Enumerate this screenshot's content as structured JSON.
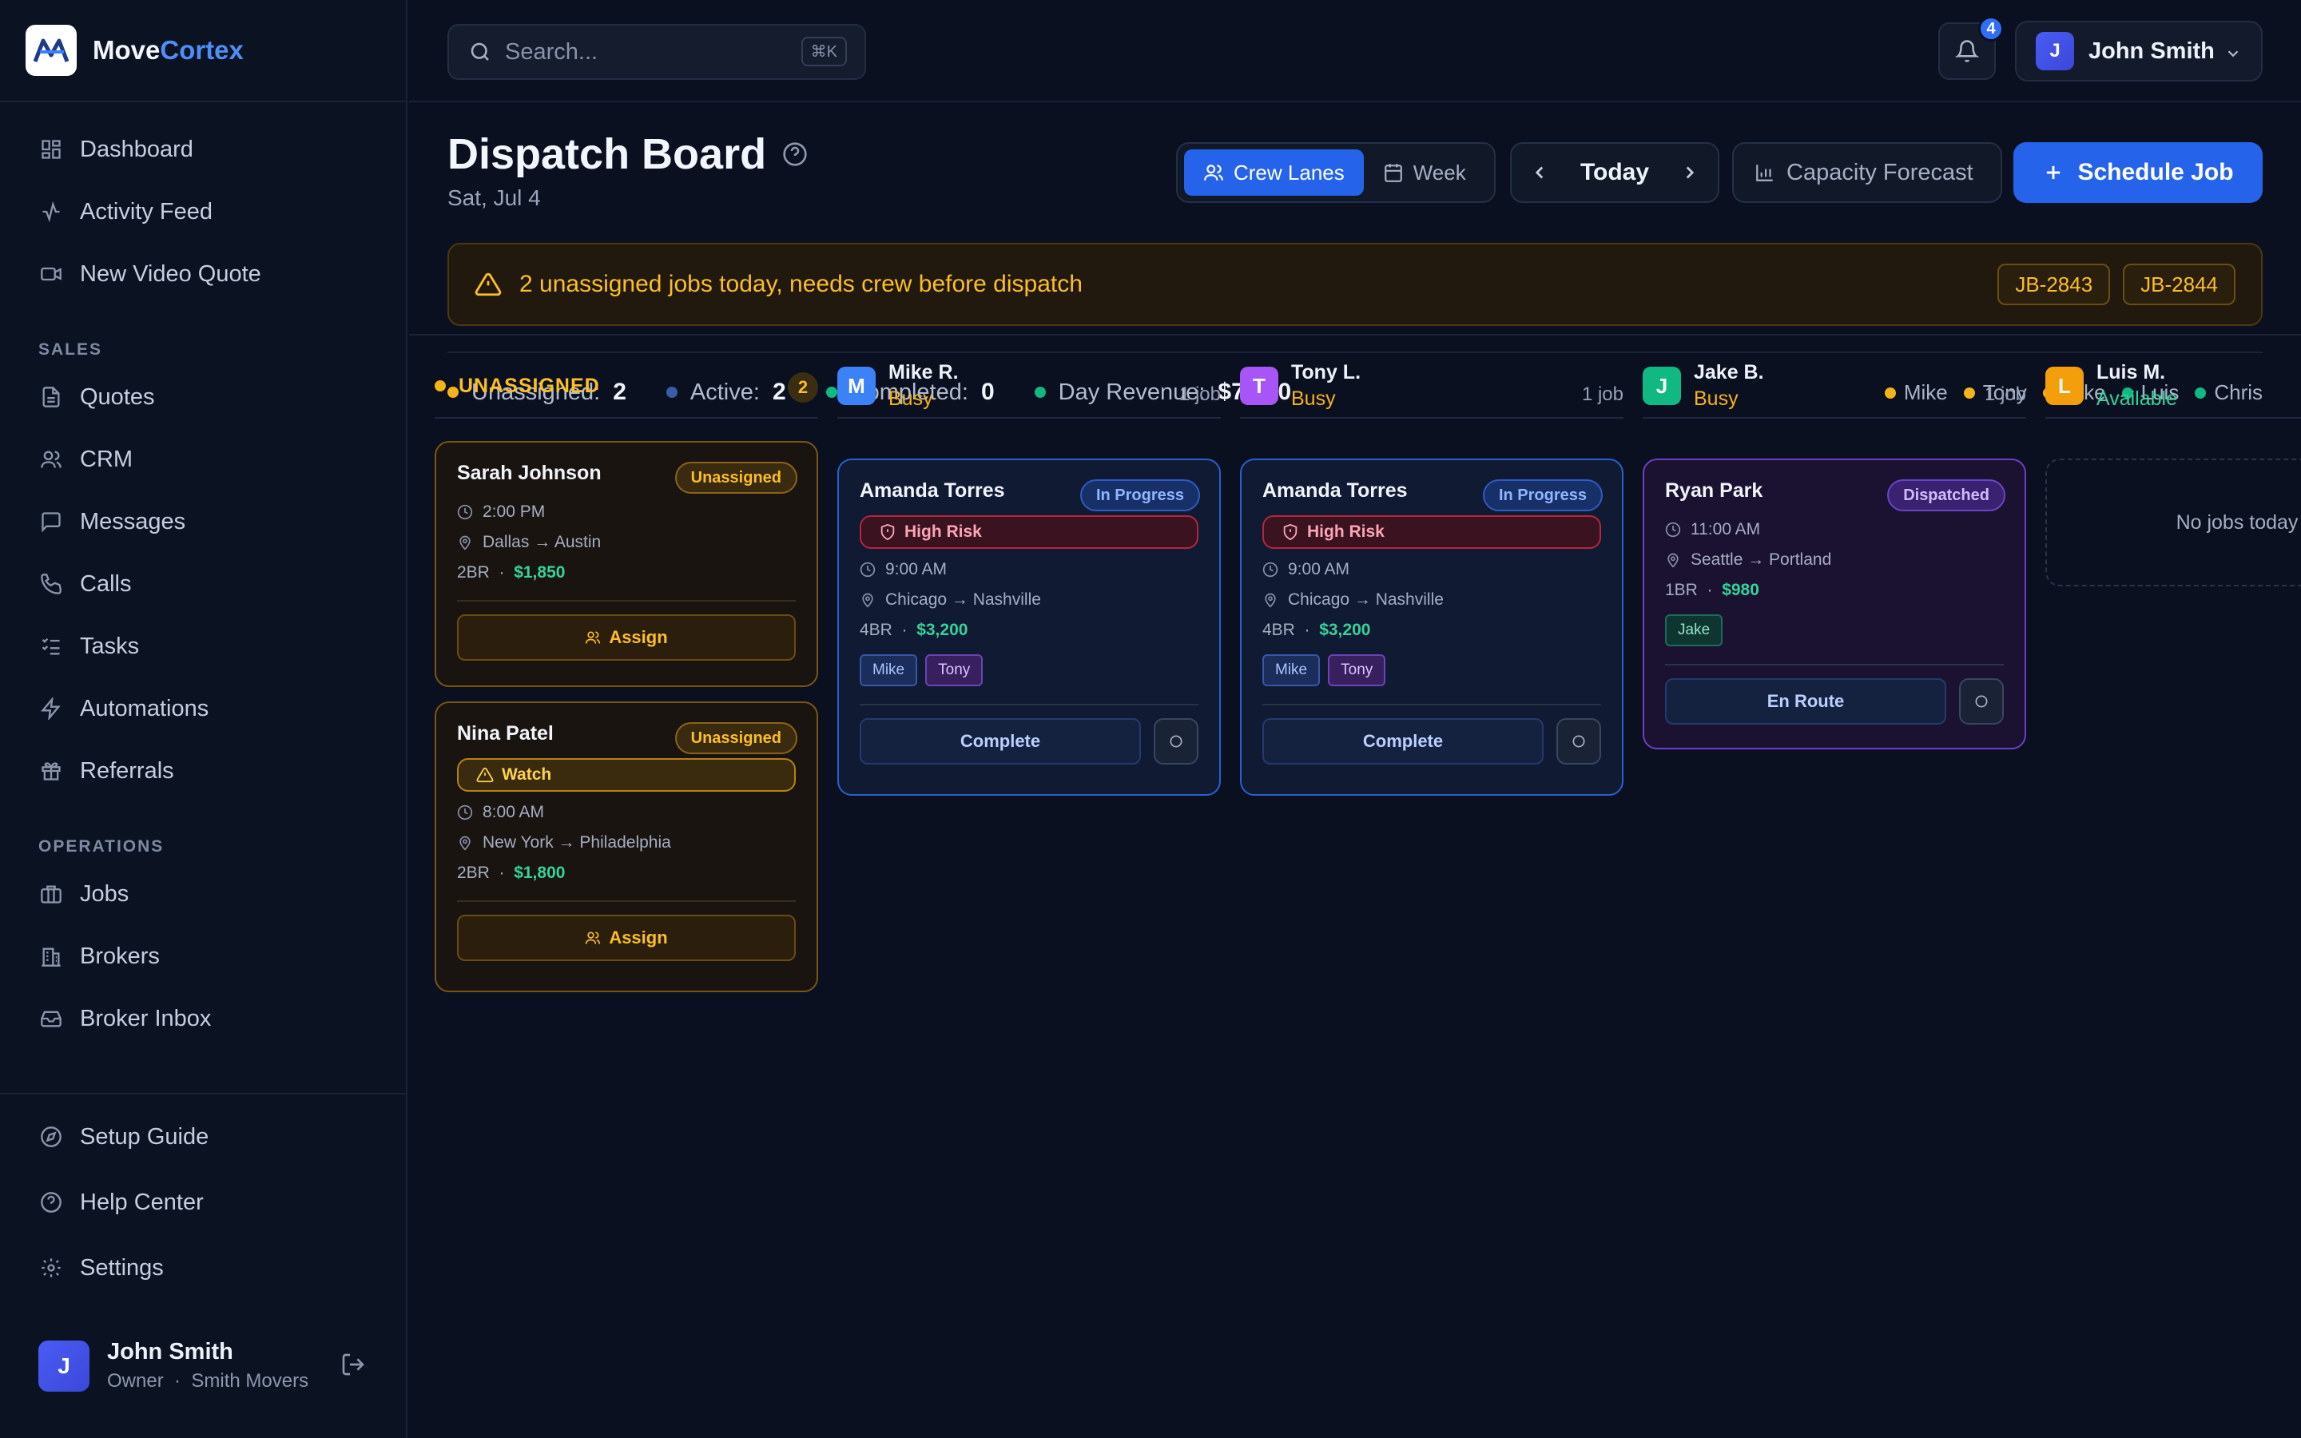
{
  "brand": {
    "name_part1": "Move",
    "name_part2": "Cortex"
  },
  "sidebar": {
    "top_items": [
      {
        "label": "Dashboard",
        "icon": "dashboard-icon"
      },
      {
        "label": "Activity Feed",
        "icon": "activity-icon"
      },
      {
        "label": "New Video Quote",
        "icon": "video-icon"
      }
    ],
    "sales_heading": "SALES",
    "sales_items": [
      {
        "label": "Quotes",
        "icon": "file-icon"
      },
      {
        "label": "CRM",
        "icon": "users-icon"
      },
      {
        "label": "Messages",
        "icon": "message-icon"
      },
      {
        "label": "Calls",
        "icon": "phone-icon"
      },
      {
        "label": "Tasks",
        "icon": "tasks-icon"
      },
      {
        "label": "Automations",
        "icon": "bolt-icon"
      },
      {
        "label": "Referrals",
        "icon": "gift-icon"
      }
    ],
    "ops_heading": "OPERATIONS",
    "ops_items": [
      {
        "label": "Jobs",
        "icon": "briefcase-icon"
      },
      {
        "label": "Brokers",
        "icon": "building-icon"
      },
      {
        "label": "Broker Inbox",
        "icon": "inbox-icon"
      }
    ],
    "bottom_items": [
      {
        "label": "Setup Guide",
        "icon": "compass-icon"
      },
      {
        "label": "Help Center",
        "icon": "help-icon"
      },
      {
        "label": "Settings",
        "icon": "gear-icon"
      }
    ],
    "user": {
      "initial": "J",
      "name": "John Smith",
      "role": "Owner",
      "company": "Smith Movers",
      "sep": "·"
    }
  },
  "topbar": {
    "search_placeholder": "Search...",
    "search_shortcut": "⌘K",
    "notification_count": "4",
    "user_initial": "J",
    "user_name": "John Smith"
  },
  "header": {
    "title": "Dispatch Board",
    "date": "Sat, Jul 4",
    "view_options": [
      "Crew Lanes",
      "Week"
    ],
    "active_view": "Crew Lanes",
    "date_nav_label": "Today",
    "forecast_label": "Capacity Forecast",
    "schedule_label": "Schedule Job"
  },
  "alert": {
    "message": "2 unassigned jobs today, needs crew before dispatch",
    "jobs": [
      "JB-2843",
      "JB-2844"
    ]
  },
  "stats": [
    {
      "label": "Unassigned:",
      "value": "2",
      "color": "#f5b31a"
    },
    {
      "label": "Active:",
      "value": "2",
      "color": "#3b5ba5"
    },
    {
      "label": "Completed:",
      "value": "0",
      "color": "#10b981"
    },
    {
      "label": "Day Revenue:",
      "value": "$7,830",
      "color": "#10b981"
    }
  ],
  "crew_legend": [
    {
      "name": "Mike",
      "color": "#f5b31a"
    },
    {
      "name": "Tony",
      "color": "#f5b31a"
    },
    {
      "name": "Jake",
      "color": "#f5b31a"
    },
    {
      "name": "Luis",
      "color": "#10b981"
    },
    {
      "name": "Chris",
      "color": "#10b981"
    }
  ],
  "unassigned": {
    "heading": "UNASSIGNED",
    "count": "2",
    "cards": [
      {
        "name": "Sarah Johnson",
        "status": "Unassigned",
        "time": "2:00 PM",
        "route": "Dallas → Austin",
        "size": "2BR",
        "sep": "·",
        "price": "$1,850",
        "action": "Assign"
      },
      {
        "name": "Nina Patel",
        "status": "Unassigned",
        "risk": "Watch",
        "time": "8:00 AM",
        "route": "New York → Philadelphia",
        "size": "2BR",
        "sep": "·",
        "price": "$1,800",
        "action": "Assign"
      }
    ]
  },
  "crews": [
    {
      "initial": "M",
      "name": "Mike R.",
      "status": "Busy",
      "count": "1 job",
      "color": "#3b82f6",
      "status_color": "#f5b31a",
      "card": {
        "name": "Amanda Torres",
        "status": "In Progress",
        "risk": "High Risk",
        "time": "9:00 AM",
        "route": "Chicago → Nashville",
        "size": "4BR",
        "sep": "·",
        "price": "$3,200",
        "tags": [
          "Mike",
          "Tony"
        ],
        "action": "Complete"
      }
    },
    {
      "initial": "T",
      "name": "Tony L.",
      "status": "Busy",
      "count": "1 job",
      "color": "#a855f7",
      "status_color": "#f5b31a",
      "card": {
        "name": "Amanda Torres",
        "status": "In Progress",
        "risk": "High Risk",
        "time": "9:00 AM",
        "route": "Chicago → Nashville",
        "size": "4BR",
        "sep": "·",
        "price": "$3,200",
        "tags": [
          "Mike",
          "Tony"
        ],
        "action": "Complete"
      }
    },
    {
      "initial": "J",
      "name": "Jake B.",
      "status": "Busy",
      "count": "1 job",
      "color": "#10b981",
      "status_color": "#f5b31a",
      "card": {
        "name": "Ryan Park",
        "status": "Dispatched",
        "time": "11:00 AM",
        "route": "Seattle → Portland",
        "size": "1BR",
        "sep": "·",
        "price": "$980",
        "tags": [
          "Jake"
        ],
        "action": "En Route"
      }
    },
    {
      "initial": "L",
      "name": "Luis M.",
      "status": "Available",
      "color": "#f59e0b",
      "status_color": "#34d399",
      "empty_text": "No jobs today"
    }
  ]
}
